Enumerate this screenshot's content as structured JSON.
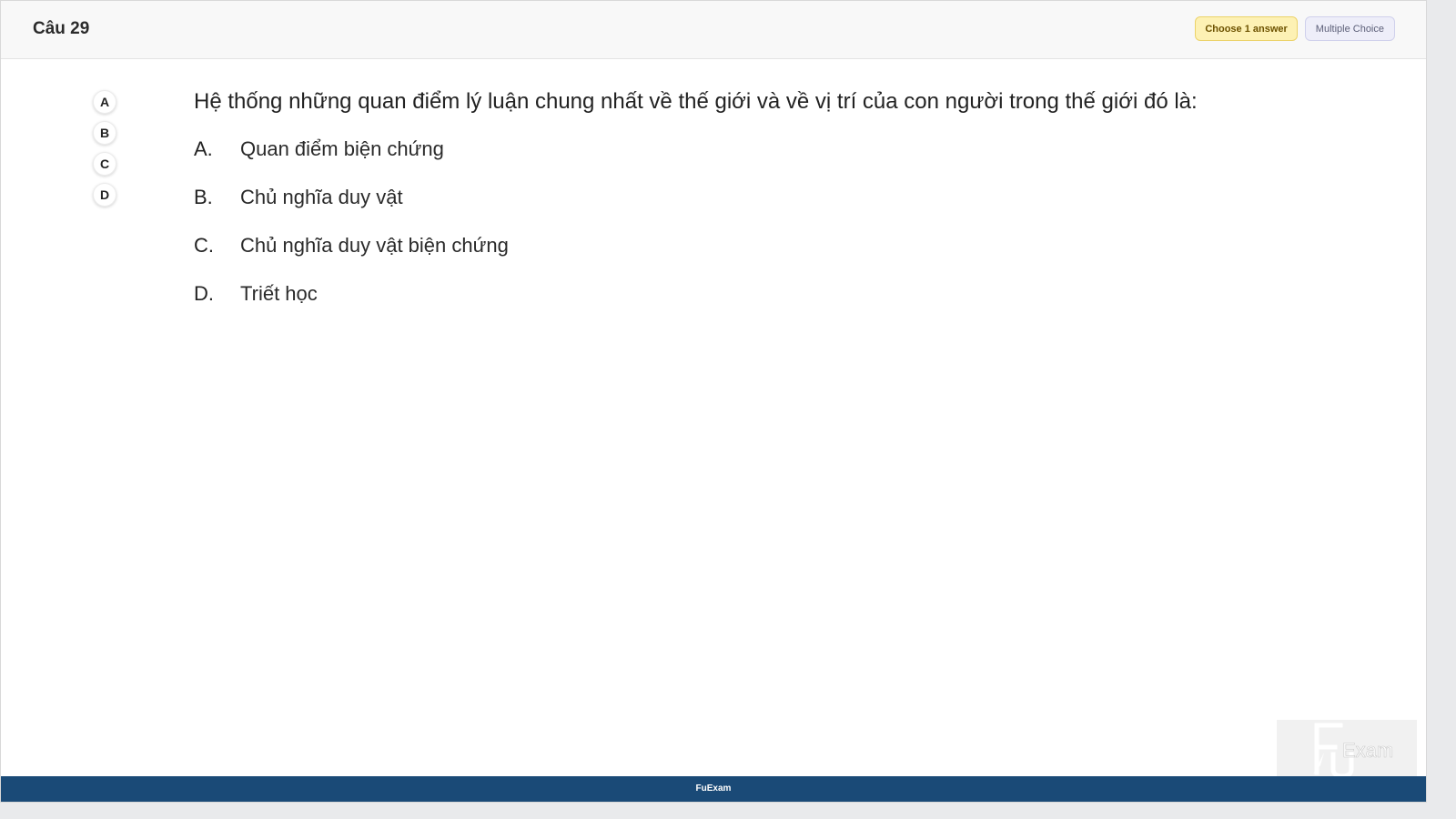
{
  "header": {
    "question_number": "Câu 29",
    "badges": {
      "choose": "Choose 1 answer",
      "type": "Multiple Choice"
    }
  },
  "nav": {
    "letters": [
      "A",
      "B",
      "C",
      "D"
    ]
  },
  "question": {
    "text": "Hệ thống những quan điểm lý luận chung nhất về thế giới và về vị trí của con người trong thế giới đó là:"
  },
  "answers": [
    {
      "letter": "A.",
      "text": "Quan điểm biện chứng"
    },
    {
      "letter": "B.",
      "text": "Chủ nghĩa duy vật"
    },
    {
      "letter": "C.",
      "text": "Chủ nghĩa duy vật biện chứng"
    },
    {
      "letter": "D.",
      "text": "Triết học"
    }
  ],
  "watermark": {
    "logo_name": "fuexam-logo",
    "text": "Exam"
  },
  "footer": {
    "text": "FuExam"
  },
  "colors": {
    "footer_bg": "#1a4a77",
    "badge_choose_bg": "#fdf1b4",
    "badge_type_bg": "#eeeef9"
  }
}
